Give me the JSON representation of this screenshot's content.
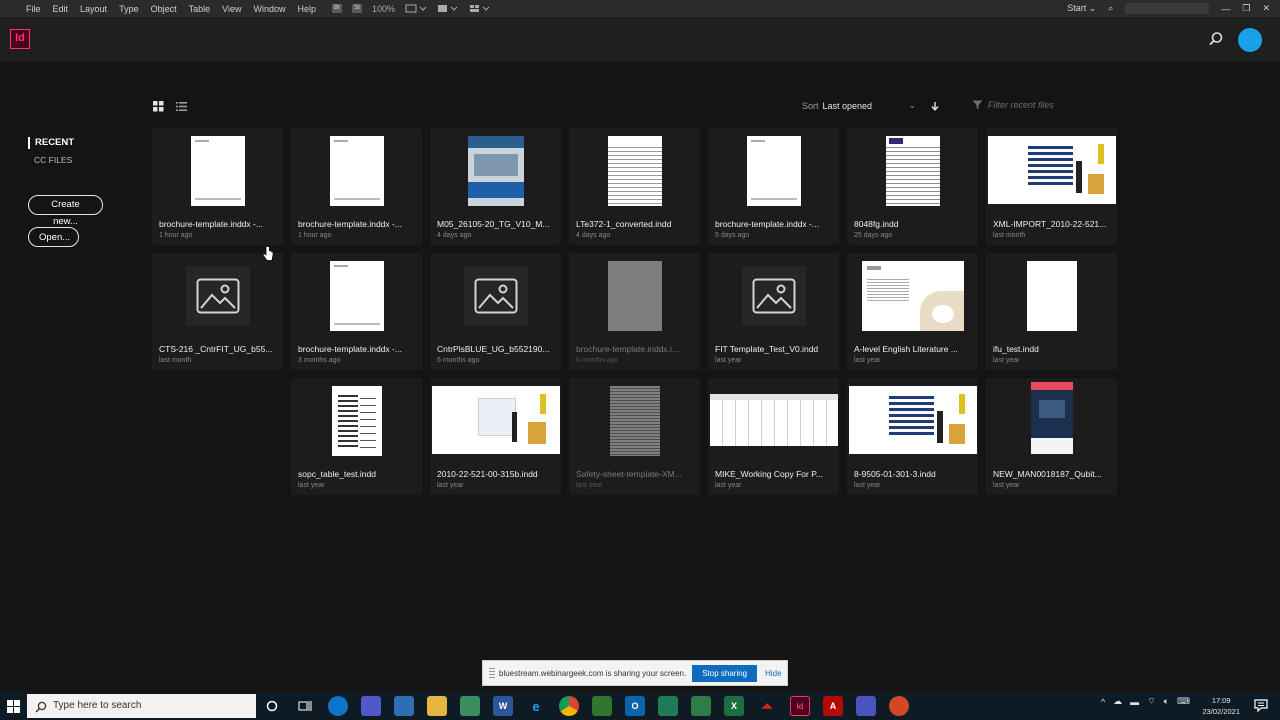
{
  "menubar": {
    "items": [
      "File",
      "Edit",
      "Layout",
      "Type",
      "Object",
      "Table",
      "View",
      "Window",
      "Help"
    ],
    "chip1": "Br",
    "chip2": "St",
    "zoom": "100%",
    "workspace": "Start"
  },
  "app": {
    "logo": "Id"
  },
  "nav": {
    "recent": "RECENT",
    "cc_files": "CC FILES",
    "create_label": "Create new...",
    "open_label": "Open..."
  },
  "toolbar": {
    "sort_label": "Sort",
    "sort_value": "Last opened",
    "filter_placeholder": "Filter recent files"
  },
  "files": [
    {
      "name": "brochure-template.inddx -...",
      "time": "1 hour ago",
      "thumb": "white"
    },
    {
      "name": "brochure-template.inddx -...",
      "time": "1 hour ago",
      "thumb": "white"
    },
    {
      "name": "M05_26105-20_TG_V10_M...",
      "time": "4 days ago",
      "thumb": "blue"
    },
    {
      "name": "LTe372-1_converted.indd",
      "time": "4 days ago",
      "thumb": "text"
    },
    {
      "name": "brochure-template.inddx -...",
      "time": "5 days ago",
      "thumb": "white"
    },
    {
      "name": "8048fg.indd",
      "time": "25 days ago",
      "thumb": "text"
    },
    {
      "name": "XML-IMPORT_2010-22-521...",
      "time": "last month",
      "thumb": "wide"
    },
    {
      "name": "CTS-216 _CntrFIT_UG_b55...",
      "time": "last month",
      "thumb": "placeholder"
    },
    {
      "name": "brochure-template.inddx -...",
      "time": "3 months ago",
      "thumb": "white"
    },
    {
      "name": "CntrPlsBLUE_UG_b552190...",
      "time": "6 months ago",
      "thumb": "placeholder"
    },
    {
      "name": "brochure-template.inddx.i...",
      "time": "6 months ago",
      "thumb": "grey",
      "dim": true
    },
    {
      "name": "FIT Template_Test_V0.indd",
      "time": "last year",
      "thumb": "placeholder"
    },
    {
      "name": "A-level English Literature ...",
      "time": "last year",
      "thumb": "photo"
    },
    {
      "name": "ifu_test.indd",
      "time": "last year",
      "thumb": "blank"
    },
    {
      "name": "sopc_table_test.indd",
      "time": "last year",
      "thumb": "table"
    },
    {
      "name": "2010-22-521-00-315b.indd",
      "time": "last year",
      "thumb": "wide2"
    },
    {
      "name": "Safety-sheet-template-XM...",
      "time": "last year",
      "thumb": "doc",
      "dim": true
    },
    {
      "name": "MIKE_Working Copy For P...",
      "time": "last year",
      "thumb": "sheet"
    },
    {
      "name": "8-9505-01-301-3.indd",
      "time": "last year",
      "thumb": "wide"
    },
    {
      "name": "NEW_MAN0018187_Qubit...",
      "time": "last year",
      "thumb": "cover"
    }
  ],
  "share": {
    "message": "bluestream.webinargeek.com is sharing your screen.",
    "stop_label": "Stop sharing",
    "hide_label": "Hide"
  },
  "taskbar": {
    "search_placeholder": "Type here to search",
    "time": "17:09",
    "date": "23/02/2021"
  }
}
